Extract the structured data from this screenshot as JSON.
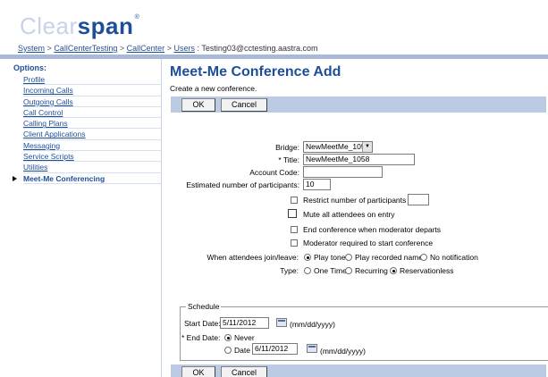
{
  "logo": {
    "part1": "Clear",
    "part2": "span",
    "mark": "®"
  },
  "breadcrumb": {
    "items": [
      "System",
      "CallCenterTesting",
      "CallCenter",
      "Users"
    ],
    "separator": ">",
    "current": ": Testing03@cctesting.aastra.com"
  },
  "sidebar": {
    "options_title": "Options:",
    "items": [
      {
        "label": "Profile"
      },
      {
        "label": "Incoming Calls"
      },
      {
        "label": "Outgoing Calls"
      },
      {
        "label": "Call Control"
      },
      {
        "label": "Calling Plans"
      },
      {
        "label": "Client Applications"
      },
      {
        "label": "Messaging"
      },
      {
        "label": "Service Scripts"
      },
      {
        "label": "Utilities"
      },
      {
        "label": "Meet-Me Conferencing"
      }
    ]
  },
  "page": {
    "title": "Meet-Me Conference Add",
    "subtitle": "Create a new conference."
  },
  "buttons": {
    "ok": "OK",
    "cancel": "Cancel"
  },
  "form": {
    "bridge_label": "Bridge:",
    "bridge_value": "NewMeetMe_1058",
    "title_label": "* Title:",
    "title_value": "NewMeetMe_1058",
    "account_code_label": "Account Code:",
    "account_code_value": "",
    "participants_label": "Estimated number of participants:",
    "participants_value": "10",
    "restrict_label": "Restrict number of participants to",
    "restrict_value": "",
    "mute_label": "Mute all attendees on entry",
    "end_conf_label": "End conference when moderator departs",
    "moderator_req_label": "Moderator required to start conference",
    "join_leave_label": "When attendees join/leave:",
    "join_leave_options": [
      "Play tone",
      "Play recorded name",
      "No notification"
    ],
    "join_leave_selected": "Play tone",
    "type_label": "Type:",
    "type_options": [
      "One Time",
      "Recurring",
      "Reservationless"
    ],
    "type_selected": "Reservationless"
  },
  "schedule": {
    "legend": "Schedule",
    "start_date_label": "Start Date:",
    "start_date_value": "5/11/2012",
    "start_date_format": "(mm/dd/yyyy)",
    "end_date_label": "* End Date:",
    "end_never_label": "Never",
    "end_date_option_label": "Date",
    "end_date_value": "6/11/2012",
    "end_date_format": "(mm/dd/yyyy)",
    "end_selected": "Never"
  }
}
